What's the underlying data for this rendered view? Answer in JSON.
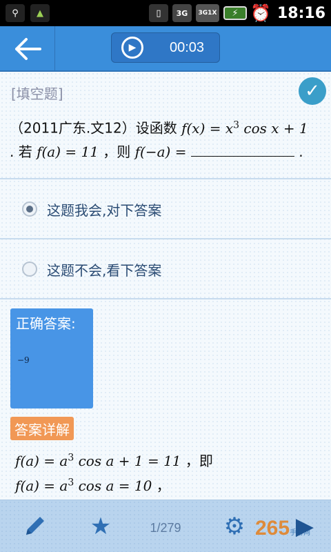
{
  "status_bar": {
    "time": "18:16",
    "network_3g": "3G",
    "network_3g1x": "3G1X"
  },
  "header": {
    "timer": "00:03"
  },
  "question": {
    "type_label": "[填空题]",
    "source": "（2011广东.文12）设函数",
    "formula_fx": "f(x) = x",
    "formula_exp": "3",
    "formula_rest": "cos x + 1",
    "line2_prefix": ". 若",
    "cond": "f(a) = 11",
    "then": "，则",
    "target": "f(−a) =",
    "end": "."
  },
  "options": [
    {
      "label": "这题我会,对下答案",
      "checked": true
    },
    {
      "label": "这题不会,看下答案",
      "checked": false
    }
  ],
  "answer": {
    "title": "正确答案:",
    "value": "−9"
  },
  "detail": {
    "label": "答案详解",
    "line1_math": "f(a) = a",
    "line1_exp": "3",
    "line1_rest": "cos a + 1 = 11",
    "line1_suffix": "，即",
    "line2_math": "f(a) = a",
    "line2_exp": "3",
    "line2_rest": "cos a = 10",
    "line2_suffix": "，"
  },
  "toolbar": {
    "page_counter": "1/279",
    "watermark": "265",
    "watermark_sub": "手游网"
  }
}
